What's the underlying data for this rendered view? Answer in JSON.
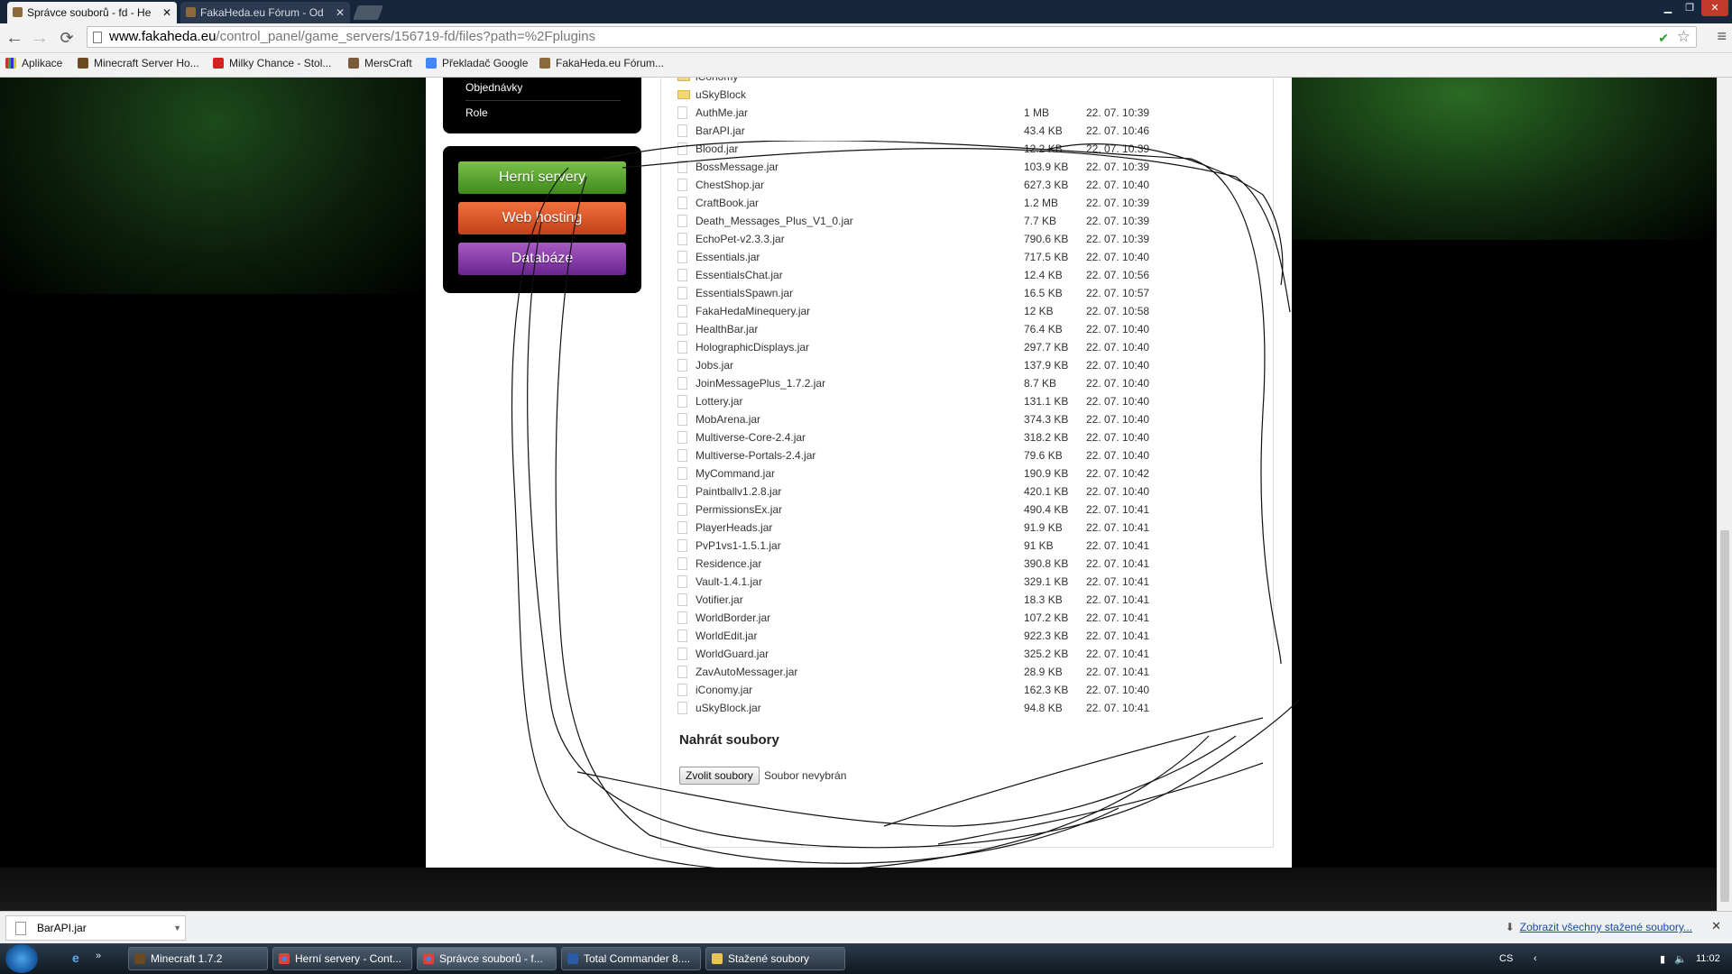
{
  "browser": {
    "tabs": [
      {
        "label": "Správce souborů - fd - He",
        "active": true
      },
      {
        "label": "FakaHeda.eu Fórum - Od",
        "active": false
      }
    ],
    "url_host": "www.fakaheda.eu",
    "url_path": "/control_panel/game_servers/156719-fd/files?path=%2Fplugins",
    "bookmarks": [
      "Aplikace",
      "Minecraft Server Ho...",
      "Milky Chance - Stol...",
      "MersCraft",
      "Překladač Google",
      "FakaHeda.eu Fórum..."
    ]
  },
  "sidebar": {
    "menu": [
      "Objednávky",
      "Role"
    ],
    "services": [
      "Herní servery",
      "Web hosting",
      "Databáze"
    ]
  },
  "files": {
    "partial_top": "iConomy",
    "folder": "uSkyBlock",
    "items": [
      {
        "name": "AuthMe.jar",
        "size": "1 MB",
        "date": "22. 07. 10:39"
      },
      {
        "name": "BarAPI.jar",
        "size": "43.4 KB",
        "date": "22. 07. 10:46"
      },
      {
        "name": "Blood.jar",
        "size": "12.2 KB",
        "date": "22. 07. 10:39"
      },
      {
        "name": "BossMessage.jar",
        "size": "103.9 KB",
        "date": "22. 07. 10:39"
      },
      {
        "name": "ChestShop.jar",
        "size": "627.3 KB",
        "date": "22. 07. 10:40"
      },
      {
        "name": "CraftBook.jar",
        "size": "1.2 MB",
        "date": "22. 07. 10:39"
      },
      {
        "name": "Death_Messages_Plus_V1_0.jar",
        "size": "7.7 KB",
        "date": "22. 07. 10:39"
      },
      {
        "name": "EchoPet-v2.3.3.jar",
        "size": "790.6 KB",
        "date": "22. 07. 10:39"
      },
      {
        "name": "Essentials.jar",
        "size": "717.5 KB",
        "date": "22. 07. 10:40"
      },
      {
        "name": "EssentialsChat.jar",
        "size": "12.4 KB",
        "date": "22. 07. 10:56"
      },
      {
        "name": "EssentialsSpawn.jar",
        "size": "16.5 KB",
        "date": "22. 07. 10:57"
      },
      {
        "name": "FakaHedaMinequery.jar",
        "size": "12 KB",
        "date": "22. 07. 10:58"
      },
      {
        "name": "HealthBar.jar",
        "size": "76.4 KB",
        "date": "22. 07. 10:40"
      },
      {
        "name": "HolographicDisplays.jar",
        "size": "297.7 KB",
        "date": "22. 07. 10:40"
      },
      {
        "name": "Jobs.jar",
        "size": "137.9 KB",
        "date": "22. 07. 10:40"
      },
      {
        "name": "JoinMessagePlus_1.7.2.jar",
        "size": "8.7 KB",
        "date": "22. 07. 10:40"
      },
      {
        "name": "Lottery.jar",
        "size": "131.1 KB",
        "date": "22. 07. 10:40"
      },
      {
        "name": "MobArena.jar",
        "size": "374.3 KB",
        "date": "22. 07. 10:40"
      },
      {
        "name": "Multiverse-Core-2.4.jar",
        "size": "318.2 KB",
        "date": "22. 07. 10:40"
      },
      {
        "name": "Multiverse-Portals-2.4.jar",
        "size": "79.6 KB",
        "date": "22. 07. 10:40"
      },
      {
        "name": "MyCommand.jar",
        "size": "190.9 KB",
        "date": "22. 07. 10:42"
      },
      {
        "name": "Paintballv1.2.8.jar",
        "size": "420.1 KB",
        "date": "22. 07. 10:40"
      },
      {
        "name": "PermissionsEx.jar",
        "size": "490.4 KB",
        "date": "22. 07. 10:41"
      },
      {
        "name": "PlayerHeads.jar",
        "size": "91.9 KB",
        "date": "22. 07. 10:41"
      },
      {
        "name": "PvP1vs1-1.5.1.jar",
        "size": "91 KB",
        "date": "22. 07. 10:41"
      },
      {
        "name": "Residence.jar",
        "size": "390.8 KB",
        "date": "22. 07. 10:41"
      },
      {
        "name": "Vault-1.4.1.jar",
        "size": "329.1 KB",
        "date": "22. 07. 10:41"
      },
      {
        "name": "Votifier.jar",
        "size": "18.3 KB",
        "date": "22. 07. 10:41"
      },
      {
        "name": "WorldBorder.jar",
        "size": "107.2 KB",
        "date": "22. 07. 10:41"
      },
      {
        "name": "WorldEdit.jar",
        "size": "922.3 KB",
        "date": "22. 07. 10:41"
      },
      {
        "name": "WorldGuard.jar",
        "size": "325.2 KB",
        "date": "22. 07. 10:41"
      },
      {
        "name": "ZavAutoMessager.jar",
        "size": "28.9 KB",
        "date": "22. 07. 10:41"
      },
      {
        "name": "iConomy.jar",
        "size": "162.3 KB",
        "date": "22. 07. 10:40"
      },
      {
        "name": "uSkyBlock.jar",
        "size": "94.8 KB",
        "date": "22. 07. 10:41"
      }
    ]
  },
  "upload": {
    "title": "Nahrát soubory",
    "choose_label": "Zvolit soubory",
    "no_file": "Soubor nevybrán"
  },
  "downloads": {
    "item": "BarAPI.jar",
    "show_all": "Zobrazit všechny stažené soubory..."
  },
  "taskbar": {
    "buttons": [
      "Minecraft 1.7.2",
      "Herní servery - Cont...",
      "Správce souborů - f...",
      "Total Commander 8....",
      "Stažené soubory"
    ],
    "lang": "CS",
    "clock": "11:02"
  }
}
